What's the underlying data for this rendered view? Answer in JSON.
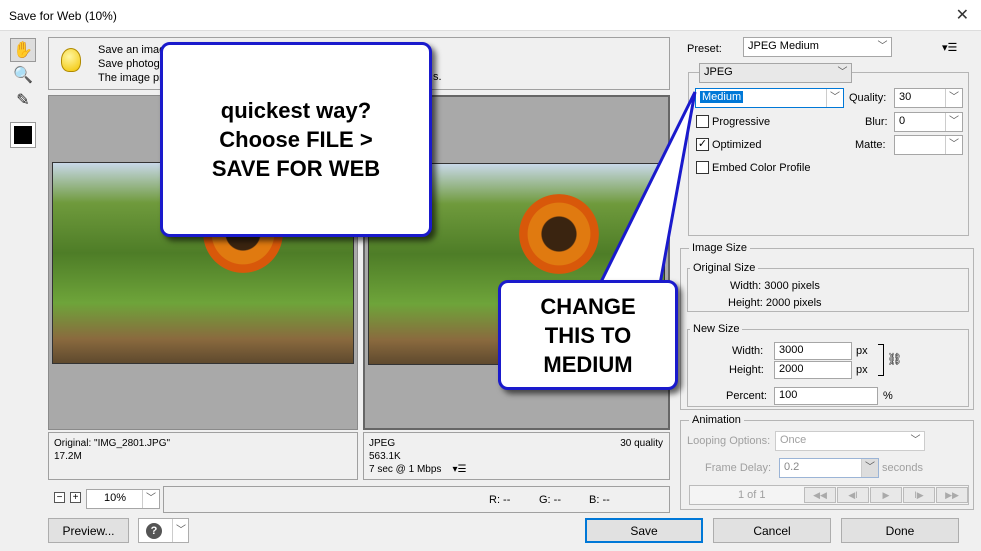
{
  "window": {
    "title": "Save for Web (10%)",
    "close": "✕"
  },
  "tools": [
    {
      "icon": "hand-icon",
      "glyph": "✋"
    },
    {
      "icon": "zoom-icon",
      "glyph": "🔍"
    },
    {
      "icon": "eyedropper-icon",
      "glyph": "✎"
    }
  ],
  "tip": {
    "line1": "Save an imag",
    "line2": "Save photog",
    "line3": "The image pr",
    "line3_end": "s."
  },
  "original_info": {
    "name": "Original: \"IMG_2801.JPG\"",
    "size": "17.2M"
  },
  "optimized_info": {
    "format": "JPEG",
    "size": "563.1K",
    "time": "7 sec @ 1 Mbps",
    "quality": "30 quality",
    "menu": "▾☰"
  },
  "zoom": {
    "minus": "−",
    "plus": "+",
    "value": "10%"
  },
  "readout": {
    "r": "R: --",
    "g": "G: --",
    "b": "B: --"
  },
  "buttons": {
    "preview": "Preview...",
    "save": "Save",
    "cancel": "Cancel",
    "done": "Done"
  },
  "settings": {
    "preset_label": "Preset:",
    "preset": "JPEG Medium",
    "format": "JPEG",
    "quality_preset": "Medium",
    "quality_label": "Quality:",
    "quality": "30",
    "blur_label": "Blur:",
    "blur": "0",
    "matte_label": "Matte:",
    "matte": "",
    "progressive": "Progressive",
    "progressive_checked": false,
    "optimized": "Optimized",
    "optimized_checked": true,
    "embed": "Embed Color Profile",
    "embed_checked": false
  },
  "image_size": {
    "title": "Image Size",
    "original_title": "Original Size",
    "orig_width": "Width:  3000 pixels",
    "orig_height": "Height:  2000 pixels",
    "new_title": "New Size",
    "width_label": "Width:",
    "width": "3000",
    "height_label": "Height:",
    "height": "2000",
    "px": "px",
    "percent_label": "Percent:",
    "percent": "100",
    "pct": "%"
  },
  "animation": {
    "title": "Animation",
    "looping_label": "Looping Options:",
    "looping": "Once",
    "delay_label": "Frame Delay:",
    "delay": "0.2",
    "seconds": "seconds",
    "frame": "1 of 1",
    "nav": [
      "◀◀",
      "◀I",
      "▶",
      "I▶",
      "▶▶"
    ]
  },
  "callouts": {
    "first": "quickest way?\nChoose FILE >\nSAVE FOR WEB",
    "second": "CHANGE\nTHIS TO\nMEDIUM"
  }
}
